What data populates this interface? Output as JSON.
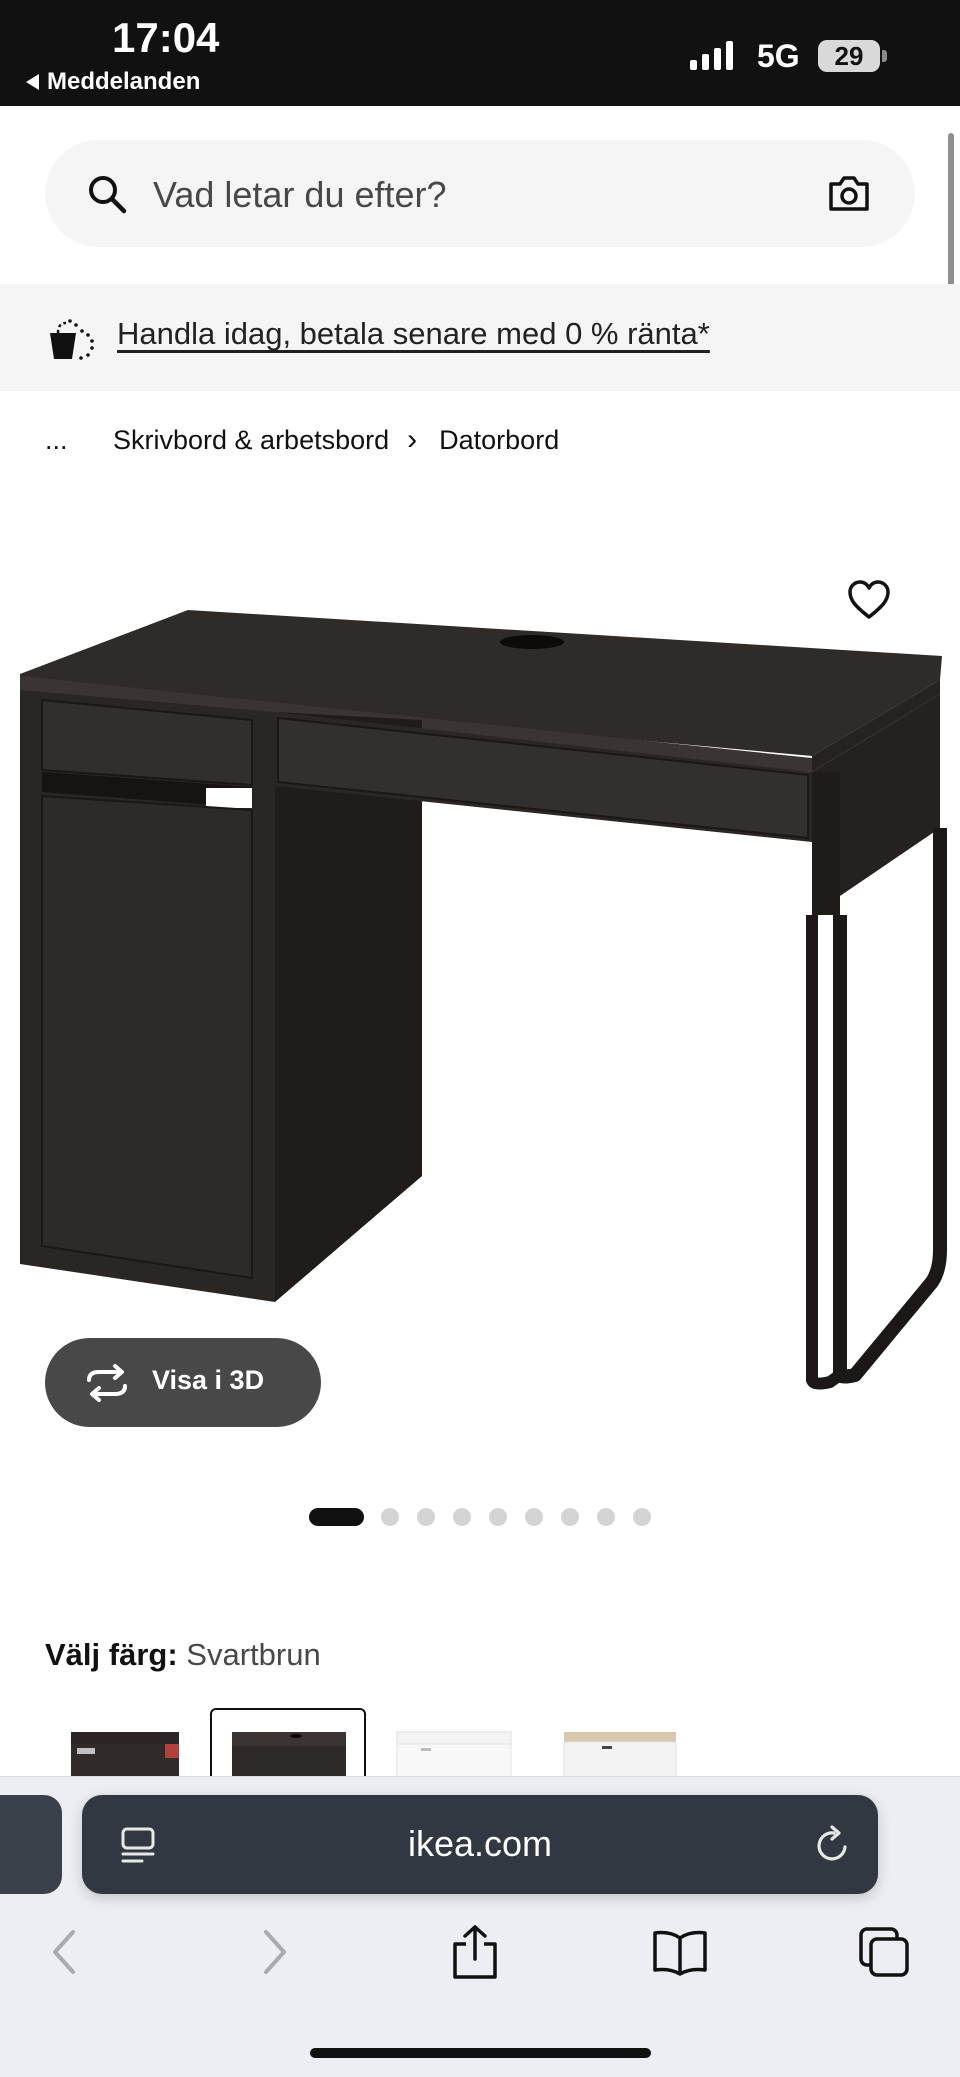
{
  "status_bar": {
    "time": "17:04",
    "back_app": "Meddelanden",
    "network": "5G",
    "battery": "29"
  },
  "search": {
    "placeholder": "Vad letar du efter?",
    "camera_icon": "camera-icon",
    "search_icon": "search-icon"
  },
  "promo": {
    "text": "Handla idag, betala senare med 0 % ränta*",
    "icon": "shopping-bag-icon"
  },
  "breadcrumb": {
    "ellipsis": "...",
    "items": [
      "Skrivbord & arbetsbord",
      "Datorbord"
    ],
    "separator": "›"
  },
  "product": {
    "favorite_icon": "heart-icon",
    "view_3d_label": "Visa i 3D",
    "carousel": {
      "count": 9,
      "active_index": 0
    }
  },
  "color_selector": {
    "label": "Välj färg:",
    "value": "Svartbrun",
    "swatches": [
      {
        "name": "black-brown-red",
        "color": "#2b2625"
      },
      {
        "name": "black-brown",
        "color": "#3a3532",
        "selected": true
      },
      {
        "name": "white",
        "color": "#f4f4f4"
      },
      {
        "name": "white-oak",
        "color": "#efeeec"
      }
    ]
  },
  "safari": {
    "url": "ikea.com",
    "buttons": [
      "back-icon",
      "forward-icon",
      "share-icon",
      "bookmarks-icon",
      "tabs-icon"
    ]
  },
  "colors": {
    "status_bar_bg": "#111111",
    "search_bg": "#f5f5f5",
    "button_dark": "#484848",
    "desk": "#2e2a27",
    "urlbar_bg": "#323842"
  }
}
